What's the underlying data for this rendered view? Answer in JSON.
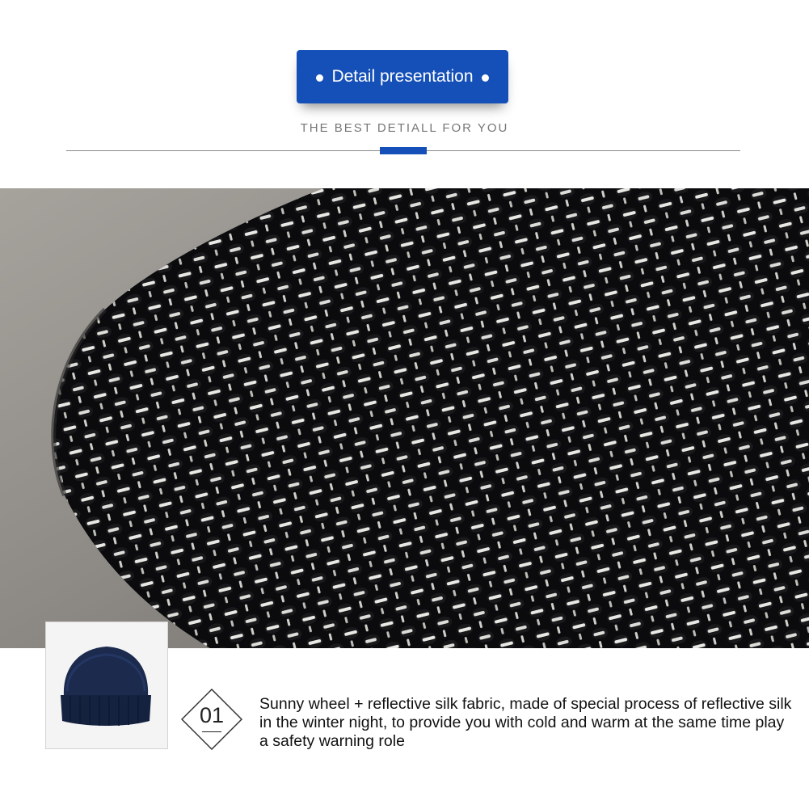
{
  "header": {
    "title": "Detail presentation",
    "subtitle": "THE BEST DETIALL FOR YOU",
    "accent_color": "#1550b8"
  },
  "feature": {
    "number": "01",
    "description": "Sunny wheel + reflective silk fabric, made of special process of reflective silk in the winter night, to provide you with cold and warm at the same time play a safety warning role"
  },
  "images": {
    "main": "reflective-knit-fabric-closeup",
    "thumbnail": "navy-knit-beanie"
  }
}
